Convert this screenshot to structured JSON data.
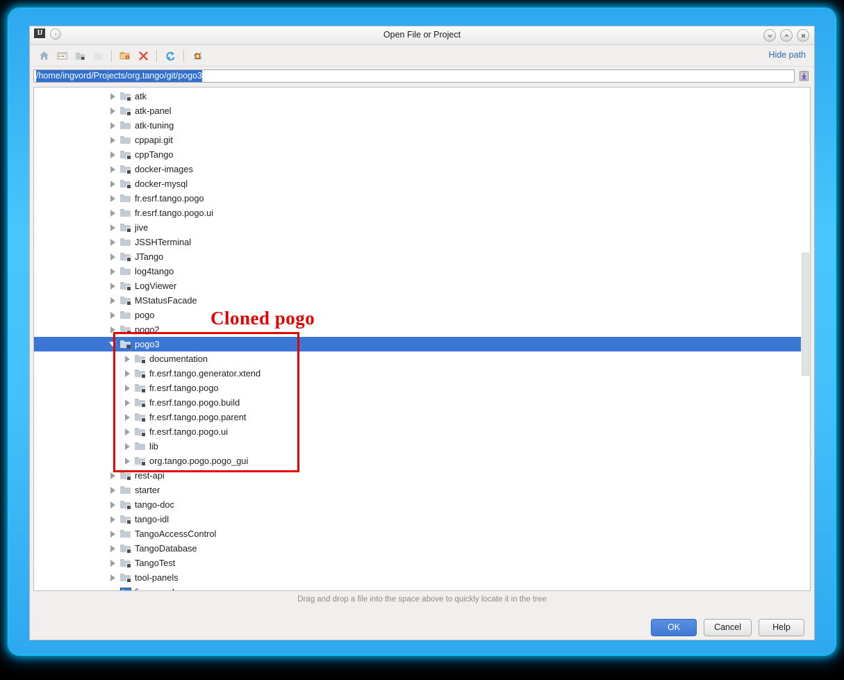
{
  "window": {
    "title": "Open File or Project",
    "app_icon": "IJ",
    "buttons": {
      "minimize": "⌄",
      "maximize": "⌃",
      "close": "✕"
    }
  },
  "toolbar": {
    "items": [
      {
        "name": "home-icon",
        "tooltip": "Home"
      },
      {
        "name": "desktop-icon",
        "tooltip": "Desktop"
      },
      {
        "name": "project-folder-icon",
        "tooltip": "Project Directory"
      },
      {
        "name": "module-folder-icon",
        "tooltip": "Module Directory"
      },
      {
        "name": "new-folder-icon",
        "tooltip": "New Folder"
      },
      {
        "name": "delete-icon",
        "tooltip": "Delete"
      },
      {
        "name": "refresh-icon",
        "tooltip": "Refresh"
      },
      {
        "name": "show-hidden-icon",
        "tooltip": "Show Hidden Files"
      }
    ],
    "hide_path_label": "Hide path"
  },
  "path": {
    "value": "/home/ingvord/Projects/org.tango/git/pogo3",
    "placeholder": "",
    "paste_icon": "paste-icon"
  },
  "tree": {
    "rows": [
      {
        "label": "atk",
        "depth": 1,
        "icon": "folder-module",
        "state": "collapsed"
      },
      {
        "label": "atk-panel",
        "depth": 1,
        "icon": "folder-module",
        "state": "collapsed"
      },
      {
        "label": "atk-tuning",
        "depth": 1,
        "icon": "folder",
        "state": "collapsed"
      },
      {
        "label": "cppapi.git",
        "depth": 1,
        "icon": "folder",
        "state": "collapsed"
      },
      {
        "label": "cppTango",
        "depth": 1,
        "icon": "folder-module",
        "state": "collapsed"
      },
      {
        "label": "docker-images",
        "depth": 1,
        "icon": "folder-module",
        "state": "collapsed"
      },
      {
        "label": "docker-mysql",
        "depth": 1,
        "icon": "folder-module",
        "state": "collapsed"
      },
      {
        "label": "fr.esrf.tango.pogo",
        "depth": 1,
        "icon": "folder",
        "state": "collapsed"
      },
      {
        "label": "fr.esrf.tango.pogo.ui",
        "depth": 1,
        "icon": "folder",
        "state": "collapsed"
      },
      {
        "label": "jive",
        "depth": 1,
        "icon": "folder-module",
        "state": "collapsed"
      },
      {
        "label": "JSSHTerminal",
        "depth": 1,
        "icon": "folder",
        "state": "collapsed"
      },
      {
        "label": "JTango",
        "depth": 1,
        "icon": "folder-module",
        "state": "collapsed"
      },
      {
        "label": "log4tango",
        "depth": 1,
        "icon": "folder",
        "state": "collapsed"
      },
      {
        "label": "LogViewer",
        "depth": 1,
        "icon": "folder-module",
        "state": "collapsed"
      },
      {
        "label": "MStatusFacade",
        "depth": 1,
        "icon": "folder-module",
        "state": "collapsed"
      },
      {
        "label": "pogo",
        "depth": 1,
        "icon": "folder",
        "state": "collapsed"
      },
      {
        "label": "pogo2",
        "depth": 1,
        "icon": "folder-module",
        "state": "collapsed"
      },
      {
        "label": "pogo3",
        "depth": 1,
        "icon": "folder-module",
        "state": "expanded",
        "selected": true
      },
      {
        "label": "documentation",
        "depth": 2,
        "icon": "folder-module",
        "state": "collapsed"
      },
      {
        "label": "fr.esrf.tango.generator.xtend",
        "depth": 2,
        "icon": "folder-module",
        "state": "collapsed"
      },
      {
        "label": "fr.esrf.tango.pogo",
        "depth": 2,
        "icon": "folder-module",
        "state": "collapsed"
      },
      {
        "label": "fr.esrf.tango.pogo.build",
        "depth": 2,
        "icon": "folder-module",
        "state": "collapsed"
      },
      {
        "label": "fr.esrf.tango.pogo.parent",
        "depth": 2,
        "icon": "folder-module",
        "state": "collapsed"
      },
      {
        "label": "fr.esrf.tango.pogo.ui",
        "depth": 2,
        "icon": "folder-module",
        "state": "collapsed"
      },
      {
        "label": "lib",
        "depth": 2,
        "icon": "folder",
        "state": "collapsed"
      },
      {
        "label": "org.tango.pogo.pogo_gui",
        "depth": 2,
        "icon": "folder-module",
        "state": "collapsed"
      },
      {
        "label": "rest-api",
        "depth": 1,
        "icon": "folder-module",
        "state": "collapsed"
      },
      {
        "label": "starter",
        "depth": 1,
        "icon": "folder",
        "state": "collapsed"
      },
      {
        "label": "tango-doc",
        "depth": 1,
        "icon": "folder-module",
        "state": "collapsed"
      },
      {
        "label": "tango-idl",
        "depth": 1,
        "icon": "folder-module",
        "state": "collapsed"
      },
      {
        "label": "TangoAccessControl",
        "depth": 1,
        "icon": "folder",
        "state": "collapsed"
      },
      {
        "label": "TangoDatabase",
        "depth": 1,
        "icon": "folder-module",
        "state": "collapsed"
      },
      {
        "label": "TangoTest",
        "depth": 1,
        "icon": "folder-module",
        "state": "collapsed"
      },
      {
        "label": "tool-panels",
        "depth": 1,
        "icon": "folder-module",
        "state": "collapsed"
      },
      {
        "label": "fix_user.sh",
        "depth": 1,
        "icon": "shell-script",
        "state": "none"
      }
    ]
  },
  "annotation": {
    "label": "Cloned pogo",
    "color": "#e60000"
  },
  "hint": "Drag and drop a file into the space above to quickly locate it in the tree",
  "footer": {
    "ok_label": "OK",
    "cancel_label": "Cancel",
    "help_label": "Help"
  },
  "colors": {
    "selection": "#3c76d4",
    "accent_link": "#2b6ab5",
    "annotation": "#e60000",
    "window_glow": "#49c6fb"
  }
}
